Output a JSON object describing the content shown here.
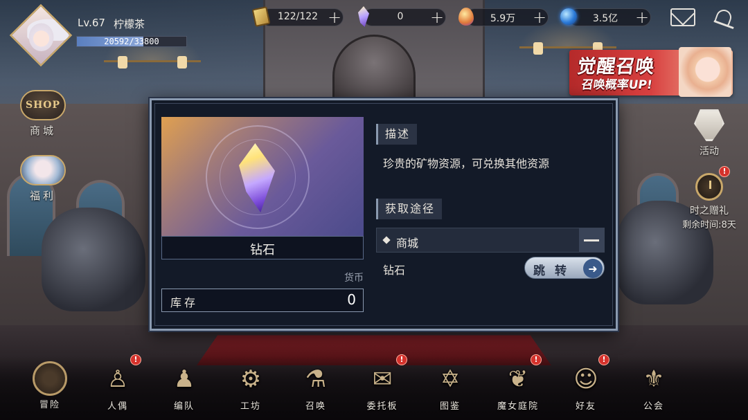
{
  "player": {
    "level": "Lv.67",
    "name": "柠檬茶",
    "exp": "20592/33800",
    "exp_progress": 0.609
  },
  "resources": [
    {
      "icon": "paper-token-icon",
      "value": "122/122"
    },
    {
      "icon": "diamond-icon",
      "value": "0"
    },
    {
      "icon": "essence-drop-icon",
      "value": "5.9万"
    },
    {
      "icon": "mana-orb-icon",
      "value": "3.5亿"
    }
  ],
  "banner": {
    "title": "觉醒召唤",
    "subtitle": "召唤概率UP!"
  },
  "left_menu": [
    {
      "badge": "SHOP",
      "label": "商城"
    },
    {
      "label": "福利"
    }
  ],
  "right_menu": {
    "event_label": "活动",
    "gift_label": "时之赠礼",
    "gift_time": "剩余时间:8天"
  },
  "dialog": {
    "item_name": "钻石",
    "item_type": "货币",
    "stock_label": "库存",
    "stock_value": "0",
    "desc_title": "描述",
    "desc_text": "珍贵的矿物资源，可兑换其他资源",
    "source_title": "获取途径",
    "source_name": "商城",
    "source_item": "钻石",
    "jump_label": "跳转"
  },
  "bottom_nav": [
    {
      "label": "冒险",
      "icon": "adventure-icon",
      "alert": false
    },
    {
      "label": "人偶",
      "icon": "doll-icon",
      "alert": true
    },
    {
      "label": "编队",
      "icon": "formation-icon",
      "alert": false
    },
    {
      "label": "工坊",
      "icon": "workshop-icon",
      "alert": false
    },
    {
      "label": "召唤",
      "icon": "summon-icon",
      "alert": false
    },
    {
      "label": "委托板",
      "icon": "commission-icon",
      "alert": true
    },
    {
      "label": "图鉴",
      "icon": "codex-icon",
      "alert": false
    },
    {
      "label": "魔女庭院",
      "icon": "witch-garden-icon",
      "alert": true
    },
    {
      "label": "好友",
      "icon": "friends-icon",
      "alert": true
    },
    {
      "label": "公会",
      "icon": "guild-icon",
      "alert": false
    }
  ],
  "alert_mark": "!",
  "colors": {
    "accent_gold": "#c9a86a",
    "alert_red": "#d5322c",
    "dialog_bg": "#131a28"
  }
}
